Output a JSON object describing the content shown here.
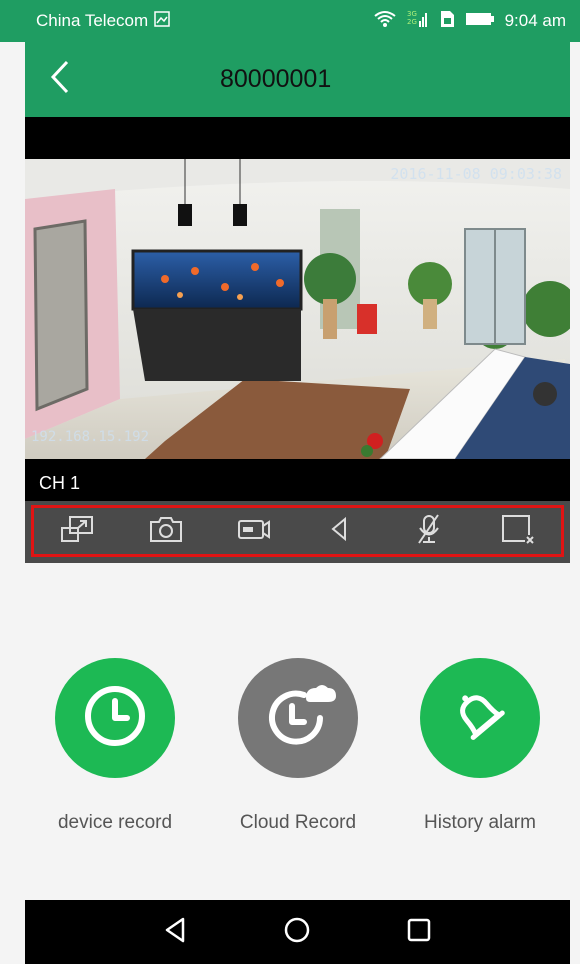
{
  "status_bar": {
    "carrier": "China Telecom",
    "time": "9:04 am",
    "icons": [
      "image-icon",
      "wifi-icon",
      "signal-3g-icon",
      "sim-icon",
      "battery-icon"
    ]
  },
  "header": {
    "title": "80000001",
    "back_icon": "back-arrow-icon"
  },
  "video": {
    "osd_timestamp": "2016-11-08 09:03:38",
    "osd_ip": "192.168.15.192",
    "channel_label": "CH 1"
  },
  "toolbar": {
    "buttons": [
      {
        "name": "fullscreen-icon"
      },
      {
        "name": "camera-icon"
      },
      {
        "name": "record-icon"
      },
      {
        "name": "speaker-icon"
      },
      {
        "name": "mic-muted-icon"
      },
      {
        "name": "close-window-icon"
      }
    ],
    "highlight_color": "#e01414"
  },
  "actions": [
    {
      "label": "device record",
      "icon": "clock-icon",
      "color": "#1db954"
    },
    {
      "label": "Cloud Record",
      "icon": "cloud-clock-icon",
      "color": "#777777"
    },
    {
      "label": "History alarm",
      "icon": "bell-icon",
      "color": "#1db954"
    }
  ],
  "nav_bar": {
    "buttons": [
      "back-triangle-icon",
      "home-circle-icon",
      "recents-square-icon"
    ]
  },
  "colors": {
    "brand_green": "#1f9d62",
    "action_green": "#1db954",
    "toolbar_bg": "#4a4a4a"
  }
}
